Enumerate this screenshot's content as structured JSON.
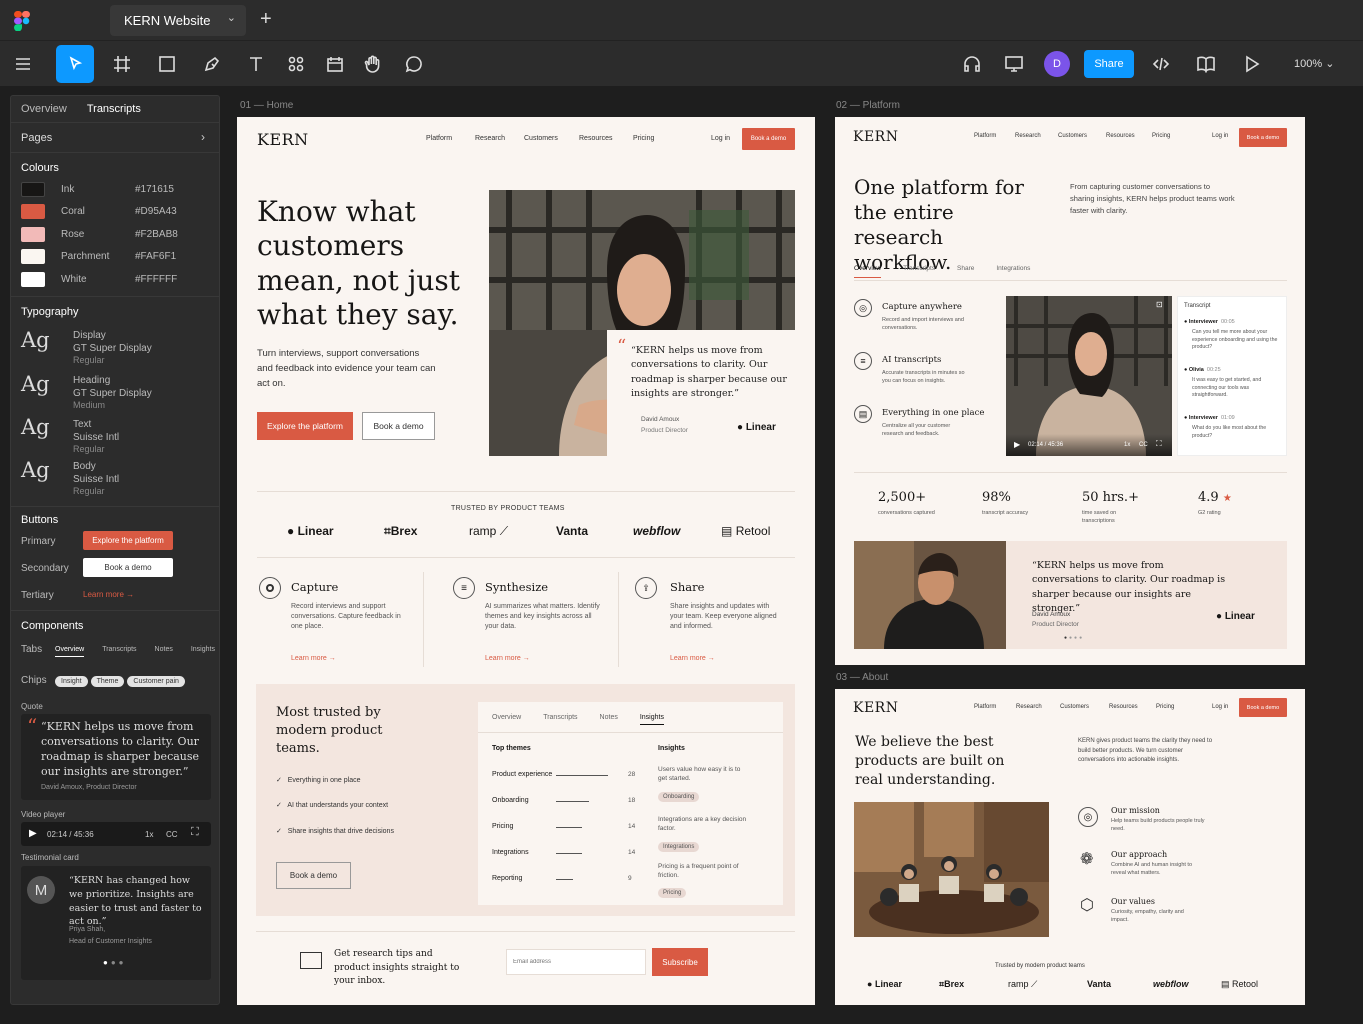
{
  "app": {
    "doc_tab": "KERN Website",
    "zoom": "100%",
    "share": "Share",
    "avatar": "D"
  },
  "panel": {
    "tabs": [
      "Overview",
      "Transcripts",
      "Notes",
      "Insights"
    ],
    "pages": "Pages",
    "colours_title": "Colours",
    "colours": [
      {
        "name": "Ink",
        "hex": "#171615"
      },
      {
        "name": "Coral",
        "hex": "#D95A43"
      },
      {
        "name": "Rose",
        "hex": "#F2BAB8"
      },
      {
        "name": "Parchment",
        "hex": "#FAF6F1"
      },
      {
        "name": "White",
        "hex": "#FFFFFF"
      }
    ],
    "typography_title": "Typography",
    "type_styles": [
      {
        "sample": "Ag",
        "name": "Display",
        "font": "GT Super Display",
        "weight": "Regular"
      },
      {
        "sample": "Ag",
        "name": "Heading",
        "font": "GT Super Display",
        "weight": "Medium"
      },
      {
        "sample": "Ag",
        "name": "Text",
        "font": "Suisse Intl",
        "weight": "Regular"
      },
      {
        "sample": "Ag",
        "name": "Body",
        "font": "Suisse Intl",
        "weight": "Regular"
      }
    ],
    "buttons_title": "Buttons",
    "buttons": {
      "primary_label": "Primary",
      "primary": "Explore the platform",
      "secondary_label": "Secondary",
      "secondary": "Book a demo",
      "tertiary_label": "Tertiary",
      "tertiary": "Learn more"
    },
    "components_title": "Components",
    "tabs_label": "Tabs",
    "chips_label": "Chips",
    "chips": [
      "Insight",
      "Theme",
      "Customer pain"
    ],
    "quote_label": "Quote",
    "quote": "“KERN helps us move from conversations to clarity. Our roadmap is sharper because our insights are stronger.”",
    "quote_author": "David Amoux, Product Director",
    "video_label": "Video player",
    "video_time": "02:14 / 45:36",
    "video_speed": "1x",
    "video_cc": "CC",
    "testimonial_label": "Testimonial card",
    "testimonial_initial": "M",
    "testimonial": "“KERN has changed how we prioritize. Insights are easier to trust and faster to act on.”",
    "testimonial_name": "Priya Shah,",
    "testimonial_role": "Head of Customer Insights"
  },
  "frames": {
    "home_label": "01 — Home",
    "platform_label": "02 — Platform",
    "about_label": "03 — About"
  },
  "home": {
    "logo": "KERN",
    "nav": [
      "Platform",
      "Research",
      "Customers",
      "Resources",
      "Pricing"
    ],
    "login": "Log in",
    "demo": "Book a demo",
    "headline": "Know what customers mean, not just what they say.",
    "sub": "Turn interviews, support conversations and feedback into evidence your team can act on.",
    "cta_primary": "Explore the platform",
    "cta_secondary": "Book a demo",
    "quote": "“KERN helps us move from conversations to clarity. Our roadmap is sharper because our insights are stronger.”",
    "quote_name": "David Amoux",
    "quote_role": "Product Director",
    "quote_brand": "Linear",
    "trusted": "TRUSTED BY PRODUCT TEAMS",
    "logos": [
      "Linear",
      "Brex",
      "ramp",
      "Vanta",
      "webflow",
      "Retool"
    ],
    "features": [
      {
        "title": "Capture",
        "text": "Record interviews and support conversations. Capture feedback in one place.",
        "link": "Learn more"
      },
      {
        "title": "Synthesize",
        "text": "AI summarizes what matters. Identify themes and key insights across all your data.",
        "link": "Learn more"
      },
      {
        "title": "Share",
        "text": "Share insights and updates with your team. Keep everyone aligned and informed.",
        "link": "Learn more"
      }
    ],
    "trusted_title": "Most trusted by modern product teams.",
    "checks": [
      "Everything in one place",
      "AI that understands your context",
      "Share insights that drive decisions"
    ],
    "trusted_btn": "Book a demo",
    "dash_tabs": [
      "Overview",
      "Transcripts",
      "Notes",
      "Insights"
    ],
    "top_themes": "Top themes",
    "themes": [
      {
        "name": "Product experience",
        "value": 28
      },
      {
        "name": "Onboarding",
        "value": 18
      },
      {
        "name": "Pricing",
        "value": 14
      },
      {
        "name": "Integrations",
        "value": 14
      },
      {
        "name": "Reporting",
        "value": 9
      }
    ],
    "insights_title": "Insights",
    "insights": [
      {
        "text": "Users value how easy it is to get started.",
        "chip": "Onboarding"
      },
      {
        "text": "Integrations are a key decision factor.",
        "chip": "Integrations"
      },
      {
        "text": "Pricing is a frequent point of friction.",
        "chip": "Pricing"
      }
    ],
    "newsletter": "Get research tips and product insights straight to your inbox.",
    "email_placeholder": "Email address",
    "subscribe": "Subscribe"
  },
  "platform": {
    "logo": "KERN",
    "nav": [
      "Platform",
      "Research",
      "Customers",
      "Resources",
      "Pricing"
    ],
    "login": "Log in",
    "demo": "Book a demo",
    "headline": "One platform for the entire research workflow.",
    "sub": "From capturing customer conversations to sharing insights, KERN helps product teams work faster with clarity.",
    "tabs": [
      "Overview",
      "Transcripts",
      "Share",
      "Integrations"
    ],
    "features": [
      {
        "title": "Capture anywhere",
        "text": "Record and import interviews and conversations."
      },
      {
        "title": "AI transcripts",
        "text": "Accurate transcripts in minutes so you can focus on insights."
      },
      {
        "title": "Everything in one place",
        "text": "Centralize all your customer research and feedback."
      }
    ],
    "video_time": "02:14 / 45:36",
    "video_speed": "1x",
    "video_cc": "CC",
    "transcript_title": "Transcript",
    "transcript": [
      {
        "who": "Interviewer",
        "time": "00:05",
        "text": "Can you tell me more about your experience onboarding and using the product?"
      },
      {
        "who": "Olivia",
        "time": "00:25",
        "text": "It was easy to get started, and connecting our tools was straightforward."
      },
      {
        "who": "Interviewer",
        "time": "01:09",
        "text": "What do you like most about the product?"
      }
    ],
    "stats": [
      {
        "value": "2,500+",
        "label": "conversations captured"
      },
      {
        "value": "98%",
        "label": "transcript accuracy"
      },
      {
        "value": "50 hrs.+",
        "label": "time saved on transcriptions"
      },
      {
        "value": "4.9",
        "label": "G2 rating",
        "star": "★"
      }
    ],
    "quote": "“KERN helps us move from conversations to clarity. Our roadmap is sharper because our insights are stronger.”",
    "quote_name": "David Amoux",
    "quote_role": "Product Director",
    "quote_brand": "Linear"
  },
  "about": {
    "logo": "KERN",
    "nav": [
      "Platform",
      "Research",
      "Customers",
      "Resources",
      "Pricing"
    ],
    "login": "Log in",
    "demo": "Book a demo",
    "headline": "We believe the best products are built on real understanding.",
    "sub": "KERN gives product teams the clarity they need to build better products. We turn customer conversations into actionable insights.",
    "values": [
      {
        "title": "Our mission",
        "text": "Help teams build products people truly need."
      },
      {
        "title": "Our approach",
        "text": "Combine AI and human insight to reveal what matters."
      },
      {
        "title": "Our values",
        "text": "Curiosity, empathy, clarity and impact."
      }
    ],
    "trusted": "Trusted by modern product teams",
    "logos": [
      "Linear",
      "Brex",
      "ramp",
      "Vanta",
      "webflow",
      "Retool"
    ]
  }
}
